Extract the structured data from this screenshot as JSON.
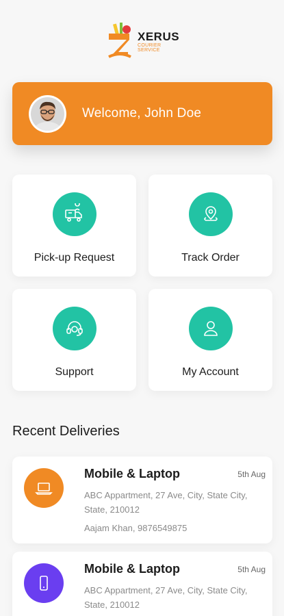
{
  "brand": {
    "name": "XERUS",
    "tagline": "COURIER SERVICE",
    "accent": "#f08a24",
    "teal": "#22c3a4"
  },
  "welcome": {
    "text": "Welcome, John Doe"
  },
  "tiles": [
    {
      "label": "Pick-up Request",
      "icon": "delivery-box-icon"
    },
    {
      "label": "Track Order",
      "icon": "location-pin-icon"
    },
    {
      "label": "Support",
      "icon": "headset-icon"
    },
    {
      "label": "My Account",
      "icon": "user-icon"
    }
  ],
  "recent": {
    "title": "Recent Deliveries",
    "items": [
      {
        "title": "Mobile & Laptop",
        "date": "5th Aug",
        "address": "ABC Appartment, 27 Ave, City, State City, State, 210012",
        "contact": "Aajam Khan, 9876549875",
        "icon": "laptop-icon",
        "color": "#f08a24"
      },
      {
        "title": "Mobile & Laptop",
        "date": "5th Aug",
        "address": "ABC Appartment, 27 Ave, City, State City, State, 210012",
        "contact": "",
        "icon": "mobile-icon",
        "color": "#6a3ef0"
      }
    ]
  }
}
